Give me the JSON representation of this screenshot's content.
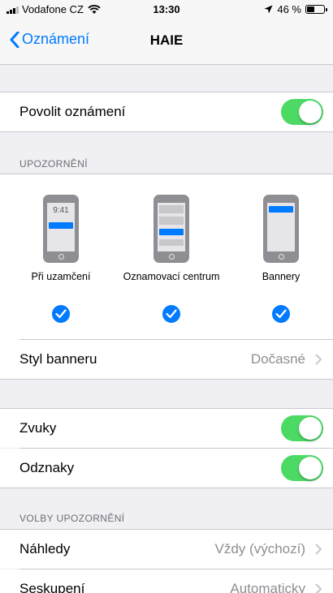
{
  "status_bar": {
    "carrier": "Vodafone CZ",
    "time": "13:30",
    "battery": "46 %",
    "battery_level": 0.46
  },
  "nav": {
    "back_label": "Oznámení",
    "title": "HAIE"
  },
  "allow": {
    "label": "Povolit oznámení",
    "on": true
  },
  "alerts_section": {
    "header": "UPOZORNĚNÍ",
    "lock_time": "9:41",
    "options": [
      {
        "label": "Při uzamčení",
        "checked": true
      },
      {
        "label": "Oznamovací centrum",
        "checked": true
      },
      {
        "label": "Bannery",
        "checked": true
      }
    ]
  },
  "banner_style": {
    "label": "Styl banneru",
    "value": "Dočasné"
  },
  "sounds": {
    "label": "Zvuky",
    "on": true
  },
  "badges": {
    "label": "Odznaky",
    "on": true
  },
  "options_section": {
    "header": "VOLBY UPOZORNĚNÍ",
    "previews": {
      "label": "Náhledy",
      "value": "Vždy (výchozí)"
    },
    "grouping": {
      "label": "Seskupení",
      "value": "Automaticky"
    }
  },
  "colors": {
    "accent": "#007aff",
    "switch_on": "#4cd964",
    "background": "#efeff4"
  }
}
